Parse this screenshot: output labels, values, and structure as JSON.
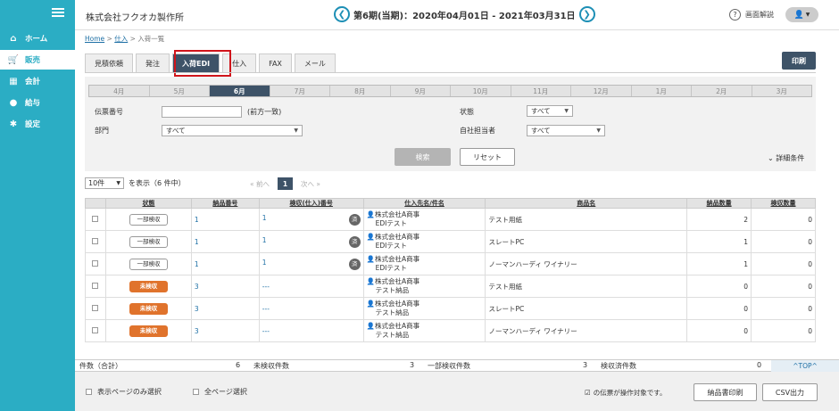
{
  "sidebar": {
    "items": [
      {
        "label": "ホーム",
        "icon": "home-icon"
      },
      {
        "label": "販売",
        "icon": "cart-icon"
      },
      {
        "label": "会計",
        "icon": "calculator-icon"
      },
      {
        "label": "給与",
        "icon": "money-bag-icon"
      },
      {
        "label": "設定",
        "icon": "gear-icon"
      }
    ]
  },
  "header": {
    "company": "株式会社フクオカ製作所",
    "period": "第6期(当期)：2020年04月01日 - 2021年03月31日",
    "help": "画面解説"
  },
  "breadcrumb": {
    "home": "Home",
    "sep": ">",
    "parent": "仕入",
    "current": "入荷一覧"
  },
  "tabs": [
    "見積依頼",
    "発注",
    "入荷EDI",
    "仕入",
    "FAX",
    "メール"
  ],
  "print_label": "印刷",
  "months": [
    "4月",
    "5月",
    "6月",
    "7月",
    "8月",
    "9月",
    "10月",
    "11月",
    "12月",
    "1月",
    "2月",
    "3月"
  ],
  "search": {
    "slip_label": "伝票番号",
    "slip_hint": "(前方一致)",
    "slip_value": "",
    "dept_label": "部門",
    "dept_value": "すべて",
    "status_label": "状態",
    "status_value": "すべて",
    "staff_label": "自社担当者",
    "staff_value": "すべて",
    "search_btn": "検索",
    "reset_btn": "リセット",
    "detail": "詳細条件"
  },
  "pager": {
    "per_page": "10件",
    "display": "を表示（6 件中）",
    "prev": "«  前へ",
    "page": "1",
    "next": "次へ  »"
  },
  "table": {
    "headers": [
      "",
      "状態",
      "納品番号",
      "検収(仕入)番号",
      "仕入先名/件名",
      "商品名",
      "納品数量",
      "検収数量"
    ],
    "rows": [
      {
        "status": "一部検収",
        "delivery": "1",
        "receipt": "1",
        "badge": "済",
        "vendor": "株式会社A商事",
        "subject": "EDIテスト",
        "product": "テスト用紙",
        "qty": "2",
        "insp": "0"
      },
      {
        "status": "一部検収",
        "delivery": "1",
        "receipt": "1",
        "badge": "済",
        "vendor": "株式会社A商事",
        "subject": "EDIテスト",
        "product": "スレートPC",
        "qty": "1",
        "insp": "0"
      },
      {
        "status": "一部検収",
        "delivery": "1",
        "receipt": "1",
        "badge": "済",
        "vendor": "株式会社A商事",
        "subject": "EDIテスト",
        "product": "ノーマンハーディ ワイナリー",
        "qty": "1",
        "insp": "0"
      },
      {
        "status": "未検収",
        "delivery": "3",
        "receipt": "---",
        "badge": "",
        "vendor": "株式会社A商事",
        "subject": "テスト納品",
        "product": "テスト用紙",
        "qty": "0",
        "insp": "0"
      },
      {
        "status": "未検収",
        "delivery": "3",
        "receipt": "---",
        "badge": "",
        "vendor": "株式会社A商事",
        "subject": "テスト納品",
        "product": "スレートPC",
        "qty": "0",
        "insp": "0"
      },
      {
        "status": "未検収",
        "delivery": "3",
        "receipt": "---",
        "badge": "",
        "vendor": "株式会社A商事",
        "subject": "テスト納品",
        "product": "ノーマンハーディ ワイナリー",
        "qty": "0",
        "insp": "0"
      }
    ]
  },
  "summary": {
    "total_label": "件数（合計）",
    "total": "6",
    "uninsp_label": "未検収件数",
    "uninsp": "3",
    "partial_label": "一部検収件数",
    "partial": "3",
    "done_label": "検収済件数",
    "done": "0",
    "to_top": "^TOP^"
  },
  "footer": {
    "page_only": "表示ページのみ選択",
    "all_pages": "全ページ選択",
    "target_note": "の伝票が操作対象です。",
    "delivery_print": "納品書印刷",
    "csv": "CSV出力"
  },
  "colors": {
    "sidebar": "#2badc4",
    "accent": "#3e5368",
    "unchecked": "#e0732c",
    "highlight": "#d0141b"
  }
}
